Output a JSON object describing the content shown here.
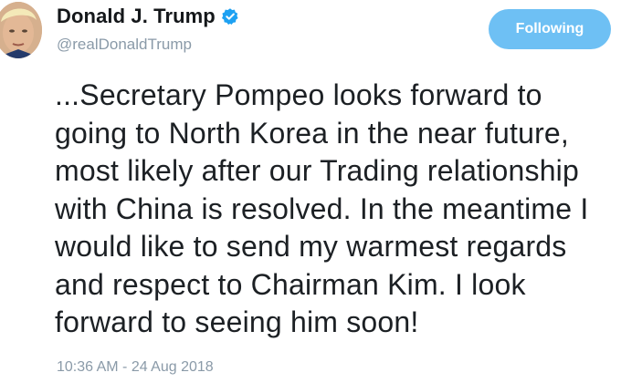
{
  "tweet": {
    "author": {
      "display_name": "Donald J. Trump",
      "handle": "@realDonaldTrump",
      "verified": true
    },
    "follow_button": {
      "label": "Following"
    },
    "text_lines": [
      "...Secretary Pompeo looks forward to",
      "going to North Korea in the near future,",
      "most likely after our Trading relationship",
      "with China is resolved. In the meantime I",
      "would like to send my warmest regards",
      "and respect to Chairman Kim. I look",
      "forward to seeing him soon!"
    ],
    "timestamp": "10:36 AM - 24 Aug 2018"
  },
  "colors": {
    "accent": "#1da1f2",
    "follow_button_bg": "#6ec0f4",
    "secondary_text": "#8a9aa8",
    "primary_text": "#14171a"
  },
  "icons": {
    "verified": "verified-badge-icon",
    "avatar": "profile-photo"
  }
}
